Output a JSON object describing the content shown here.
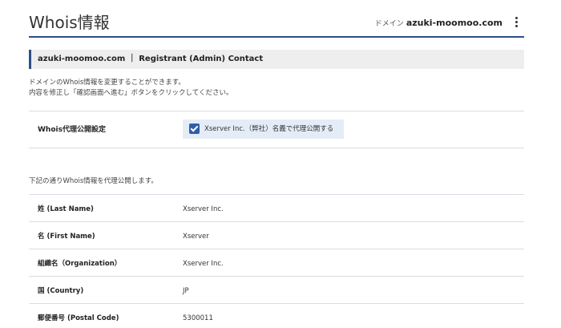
{
  "header": {
    "title": "Whois情報",
    "domain_prefix": "ドメイン",
    "domain_name": "azuki-moomoo.com",
    "menu_icon": "kebab-menu-icon"
  },
  "section": {
    "title": "azuki-moomoo.com ｜ Registrant (Admin) Contact"
  },
  "intro": {
    "line1": "ドメインのWhois情報を変更することができます。",
    "line2": "内容を修正し「確認画面へ進む」ボタンをクリックしてください。"
  },
  "proxy_setting": {
    "label": "Whois代理公開設定",
    "checkbox_label": "Xserver Inc.（弊社）名義で代理公開する",
    "checked": true
  },
  "note": "下記の通りWhois情報を代理公開します。",
  "rows": [
    {
      "label": "姓 (Last Name)",
      "value": "Xserver Inc."
    },
    {
      "label": "名 (First Name)",
      "value": "Xserver"
    },
    {
      "label": "組織名（Organization）",
      "value": "Xserver Inc."
    },
    {
      "label": "国 (Country)",
      "value": "JP"
    },
    {
      "label": "郵便番号 (Postal Code)",
      "value": "5300011"
    }
  ],
  "colors": {
    "accent": "#2c4f85",
    "checkbox": "#2c5fa8",
    "checkbox_bg": "#e4edf7",
    "section_bg": "#eeeeee"
  }
}
